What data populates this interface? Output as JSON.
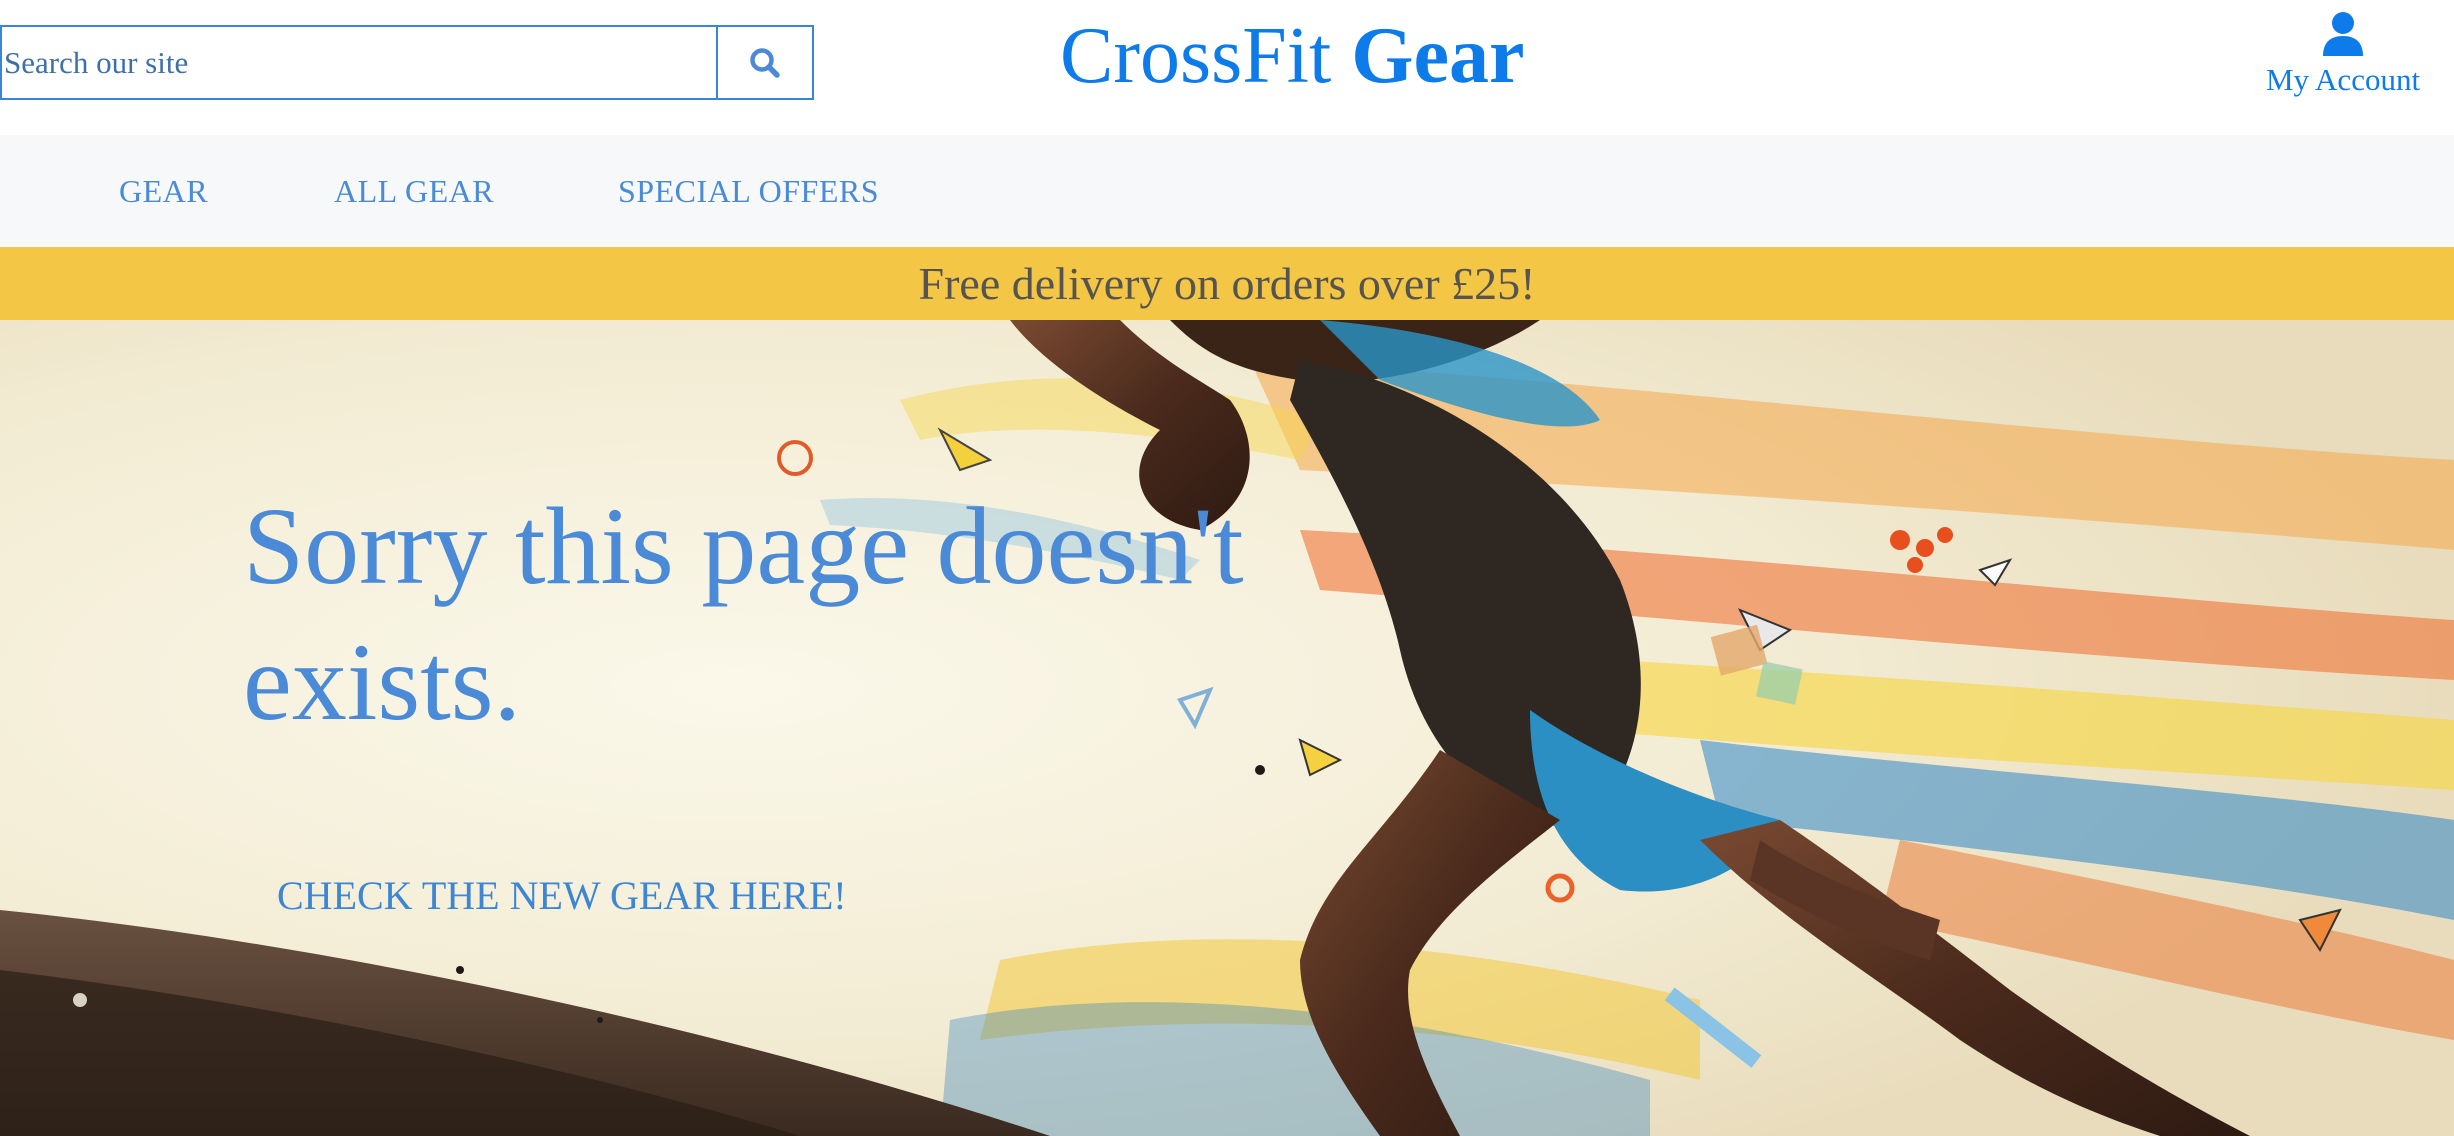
{
  "header": {
    "search": {
      "placeholder": "Search our site",
      "icon": "search-icon"
    },
    "logo": {
      "part1": "CrossFit",
      "part2": "Gear"
    },
    "account": {
      "label": "My Account",
      "icon": "user-icon"
    }
  },
  "nav": {
    "items": [
      {
        "label": "GEAR"
      },
      {
        "label": "ALL GEAR"
      },
      {
        "label": "SPECIAL OFFERS"
      }
    ]
  },
  "banner": {
    "text": "Free delivery on orders over £25!"
  },
  "hero": {
    "heading": "Sorry this page doesn't exists.",
    "cta": "CHECK THE NEW GEAR HERE!"
  },
  "colors": {
    "brand": "#0d7bea",
    "link": "#4a8ad6",
    "banner_bg": "#f4c645",
    "nav_bg": "#f7f8fa"
  }
}
